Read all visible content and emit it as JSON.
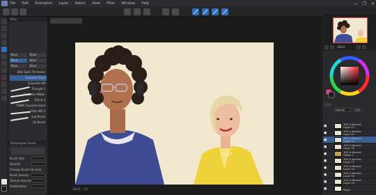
{
  "menu": [
    "File",
    "Edit",
    "Animation",
    "Layer",
    "Select",
    "View",
    "Filter",
    "Window",
    "Help"
  ],
  "window_controls": [
    "—",
    "❐",
    "✕"
  ],
  "document_tab": "…",
  "subtool": {
    "header": "Brus",
    "chips": [
      "Brus",
      "Brus",
      "Brus",
      "Brus",
      "Brus",
      "Brus"
    ],
    "brushes": [
      "(DS) Sp01 T8 theme",
      "Gouache Hard",
      "Gouache HB",
      "Triangle 2",
      "Gouache Water",
      "Rhino 2",
      "YOWA Gouache Hard",
      "Cthe WA 2",
      "sng Brush",
      "3d Brush"
    ],
    "section_label": "Rectangular Brush",
    "properties": [
      "Brush Size",
      "Opacity",
      "Change brush tip color",
      "Brush density",
      "Texture density",
      "Stabilization"
    ]
  },
  "canvas": {
    "status": "100.0 ◦ 0.0",
    "colors": {
      "background": "#f2e8d0",
      "sweater": "#3d4c93",
      "blazer": "#efd23a",
      "skin_dark": "#b0714f",
      "skin_light": "#edbf9f",
      "hair_dark": "#2b1d17",
      "hair_light": "#e8d6a6"
    }
  },
  "navigator": {
    "zoom": "100.0"
  },
  "layers": {
    "blend": "Normal",
    "opacity": "100",
    "rows": [
      {
        "name": "Layer 21",
        "mode": "100 % Normal",
        "selected": false
      },
      {
        "name": "Layer 20",
        "mode": "100 % Normal",
        "selected": false
      },
      {
        "name": "Layer 19",
        "mode": "100 % Normal",
        "selected": true
      },
      {
        "name": "Layer 18",
        "mode": "100 % Normal",
        "selected": false
      },
      {
        "name": "Folder 1",
        "mode": "100 % Normal",
        "selected": false
      },
      {
        "name": "Layer 17",
        "mode": "100 % Normal",
        "selected": false
      },
      {
        "name": "Layer 15",
        "mode": "100 % Normal",
        "selected": false
      },
      {
        "name": "Layer 16",
        "mode": "100 % Normal",
        "selected": false
      },
      {
        "name": "Layer 14",
        "mode": "100 % Normal",
        "selected": false
      },
      {
        "name": "Paper",
        "mode": "",
        "selected": false
      }
    ]
  }
}
